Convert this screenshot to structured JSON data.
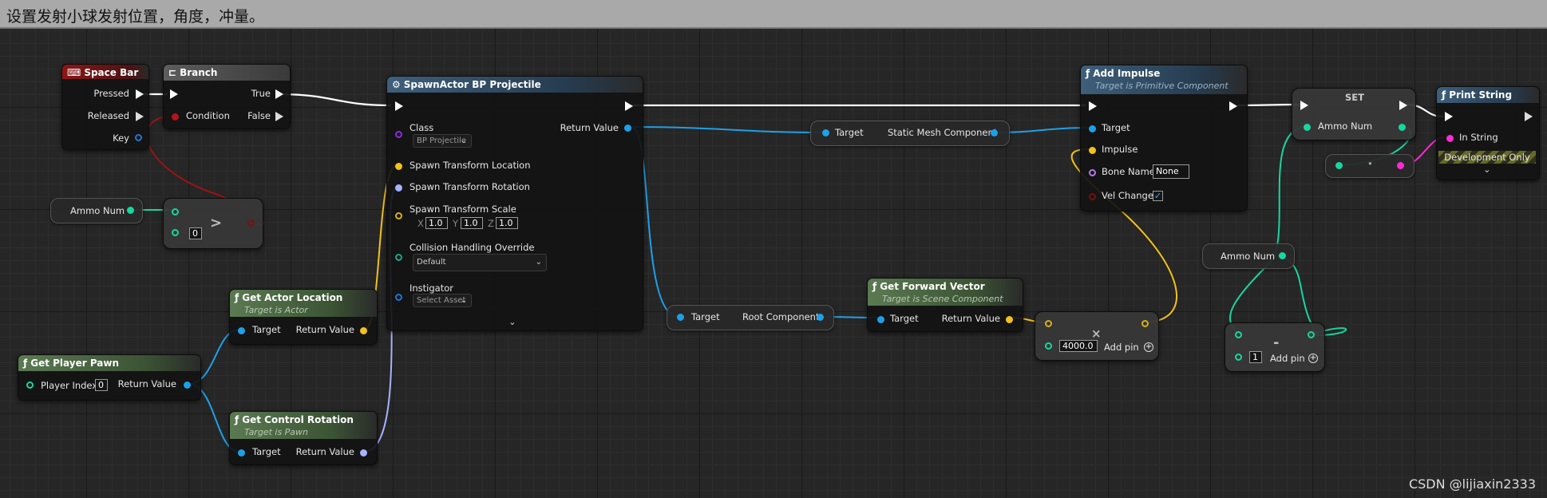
{
  "comment": {
    "title": "设置发射小球发射位置，角度，冲量。"
  },
  "watermark": "CSDN @lijiaxin2333",
  "nodes": {
    "space_bar": {
      "title": "Space Bar",
      "pressed": "Pressed",
      "released": "Released",
      "key": "Key"
    },
    "branch": {
      "title": "Branch",
      "true_label": "True",
      "condition": "Condition",
      "false_label": "False"
    },
    "ammo_num_1": {
      "label": "Ammo Num"
    },
    "greater": {
      "op": ">",
      "value": "0"
    },
    "spawn_actor": {
      "title": "SpawnActor BP Projectile",
      "class_label": "Class",
      "class_value": "BP Projectile",
      "return_value": "Return Value",
      "loc": "Spawn Transform Location",
      "rot": "Spawn Transform Rotation",
      "scale": "Spawn Transform Scale",
      "x_label": "X",
      "x_val": "1.0",
      "y_label": "Y",
      "y_val": "1.0",
      "z_label": "Z",
      "z_val": "1.0",
      "collision": "Collision Handling Override",
      "collision_value": "Default",
      "instigator": "Instigator",
      "instigator_value": "Select Asset"
    },
    "get_actor_location": {
      "title": "Get Actor Location",
      "sub": "Target is Actor",
      "target": "Target",
      "return_value": "Return Value"
    },
    "get_player_pawn": {
      "title": "Get Player Pawn",
      "player_index": "Player Index",
      "player_index_value": "0",
      "return_value": "Return Value"
    },
    "get_control_rotation": {
      "title": "Get Control Rotation",
      "sub": "Target is Pawn",
      "target": "Target",
      "return_value": "Return Value"
    },
    "static_mesh": {
      "target": "Target",
      "component": "Static Mesh Component"
    },
    "root_component": {
      "target": "Target",
      "component": "Root Component"
    },
    "get_forward_vector": {
      "title": "Get Forward Vector",
      "sub": "Target is Scene Component",
      "target": "Target",
      "return_value": "Return Value"
    },
    "multiply": {
      "op": "×",
      "value": "4000.0",
      "add_pin": "Add pin"
    },
    "add_impulse": {
      "title": "Add Impulse",
      "sub": "Target is Primitive Component",
      "target": "Target",
      "impulse": "Impulse",
      "bone_name": "Bone Name",
      "bone_value": "None",
      "vel_change": "Vel Change",
      "vel_checked": "✓"
    },
    "set_node": {
      "title": "SET",
      "ammo_num": "Ammo Num"
    },
    "conv_dot": {
      "op": "•"
    },
    "ammo_num_2": {
      "label": "Ammo Num"
    },
    "subtract": {
      "op": "-",
      "value": "1",
      "add_pin": "Add pin"
    },
    "print_string": {
      "title": "Print String",
      "in_string": "In String",
      "dev_only": "Development Only"
    }
  },
  "colors": {
    "exec": "#ffffff",
    "object": "#1ea0e8",
    "int": "#17d6a0",
    "vector": "#f2c21b",
    "rotator": "#a7b3ff",
    "bool": "#b4141c",
    "string": "#ff2bd5"
  }
}
